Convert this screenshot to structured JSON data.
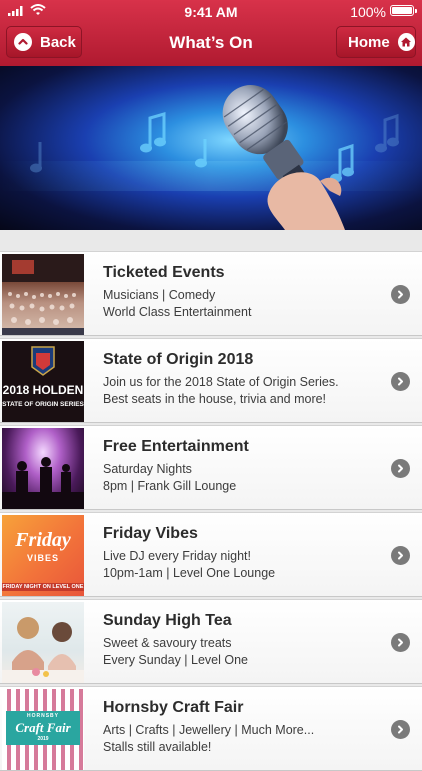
{
  "status_bar": {
    "time": "9:41 AM",
    "battery": "100%"
  },
  "header": {
    "title": "What’s On",
    "back_label": "Back",
    "home_label": "Home"
  },
  "hero": {
    "image": "microphone-hand-music-notes"
  },
  "events": [
    {
      "title": "Ticketed Events",
      "line1": "Musicians | Comedy",
      "line2": "World Class Entertainment",
      "thumb": "concert-hall-audience"
    },
    {
      "title": "State of Origin 2018",
      "line1": "Join us for the 2018 State of Origin Series.",
      "line2": "Best seats in the house, trivia and more!",
      "thumb": "holden-origin-logo",
      "thumb_text1": "2018 HOLDEN",
      "thumb_text2": "STATE OF ORIGIN SERIES"
    },
    {
      "title": "Free Entertainment",
      "line1": "Saturday Nights",
      "line2": "8pm | Frank Gill Lounge",
      "thumb": "live-band-silhouette"
    },
    {
      "title": "Friday Vibes",
      "line1": "Live DJ every Friday night!",
      "line2": "10pm-1am | Level One Lounge",
      "thumb": "friday-vibes-poster",
      "thumb_text1": "Friday",
      "thumb_text2": "VIBES",
      "thumb_text3": "FRIDAY NIGHT ON LEVEL ONE"
    },
    {
      "title": "Sunday High Tea",
      "line1": "Sweet & savoury treats",
      "line2": "Every Sunday | Level One",
      "thumb": "women-high-tea"
    },
    {
      "title": "Hornsby Craft Fair",
      "line1": "Arts | Crafts | Jewellery | Much More...",
      "line2": "Stalls still available!",
      "thumb": "craft-fair-logo",
      "thumb_text1": "HORNSBY",
      "thumb_text2": "Craft Fair",
      "thumb_text3": "2019"
    }
  ],
  "colors": {
    "header_red": "#c42238",
    "chevron_gray": "#7a7a7a"
  }
}
